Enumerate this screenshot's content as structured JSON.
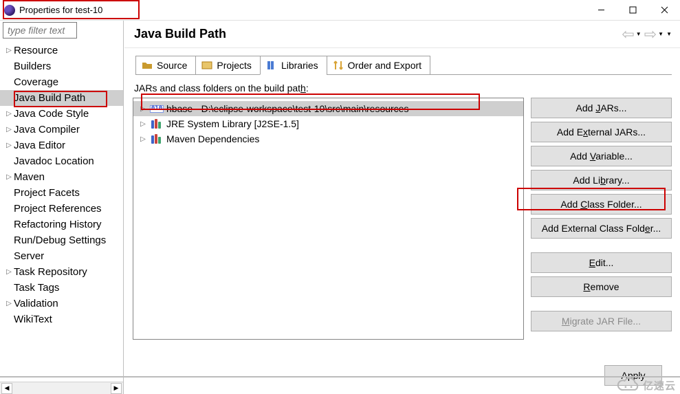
{
  "window": {
    "title": "Properties for test-10"
  },
  "filter": {
    "placeholder": "type filter text"
  },
  "sidebar": {
    "items": [
      {
        "label": "Resource",
        "expandable": true
      },
      {
        "label": "Builders",
        "expandable": false
      },
      {
        "label": "Coverage",
        "expandable": false
      },
      {
        "label": "Java Build Path",
        "expandable": false,
        "selected": true
      },
      {
        "label": "Java Code Style",
        "expandable": true
      },
      {
        "label": "Java Compiler",
        "expandable": true
      },
      {
        "label": "Java Editor",
        "expandable": true
      },
      {
        "label": "Javadoc Location",
        "expandable": false
      },
      {
        "label": "Maven",
        "expandable": true
      },
      {
        "label": "Project Facets",
        "expandable": false
      },
      {
        "label": "Project References",
        "expandable": false
      },
      {
        "label": "Refactoring History",
        "expandable": false
      },
      {
        "label": "Run/Debug Settings",
        "expandable": false
      },
      {
        "label": "Server",
        "expandable": false
      },
      {
        "label": "Task Repository",
        "expandable": true
      },
      {
        "label": "Task Tags",
        "expandable": false
      },
      {
        "label": "Validation",
        "expandable": true
      },
      {
        "label": "WikiText",
        "expandable": false
      }
    ]
  },
  "page": {
    "title": "Java Build Path",
    "tabs": {
      "source": "Source",
      "projects": "Projects",
      "libraries": "Libraries",
      "order": "Order and Export"
    },
    "desc_pre": "JARs and class folders on the build pat",
    "desc_ul": "h",
    "desc_post": ":",
    "entries": [
      {
        "label": "hbase - D:\\eclipse-workspace\\test-10\\src\\main\\resources",
        "icon": "010",
        "selected": true
      },
      {
        "label": "JRE System Library [J2SE-1.5]",
        "icon": "books",
        "selected": false
      },
      {
        "label": "Maven Dependencies",
        "icon": "books",
        "selected": false
      }
    ],
    "buttons": {
      "add_jars": {
        "pre": "Add ",
        "ul": "J",
        "post": "ARs..."
      },
      "add_ext_jars": {
        "pre": "Add E",
        "ul": "x",
        "post": "ternal JARs..."
      },
      "add_variable": {
        "pre": "Add ",
        "ul": "V",
        "post": "ariable..."
      },
      "add_library": {
        "pre": "Add Li",
        "ul": "b",
        "post": "rary..."
      },
      "add_class_folder": {
        "pre": "Add ",
        "ul": "C",
        "post": "lass Folder..."
      },
      "add_ext_class_folder": {
        "pre": "Add External Class Fold",
        "ul": "e",
        "post": "r..."
      },
      "edit": {
        "pre": "",
        "ul": "E",
        "post": "dit..."
      },
      "remove": {
        "pre": "",
        "ul": "R",
        "post": "emove"
      },
      "migrate": {
        "pre": "",
        "ul": "M",
        "post": "igrate JAR File..."
      }
    },
    "apply": "Apply"
  },
  "watermark": "亿速云"
}
